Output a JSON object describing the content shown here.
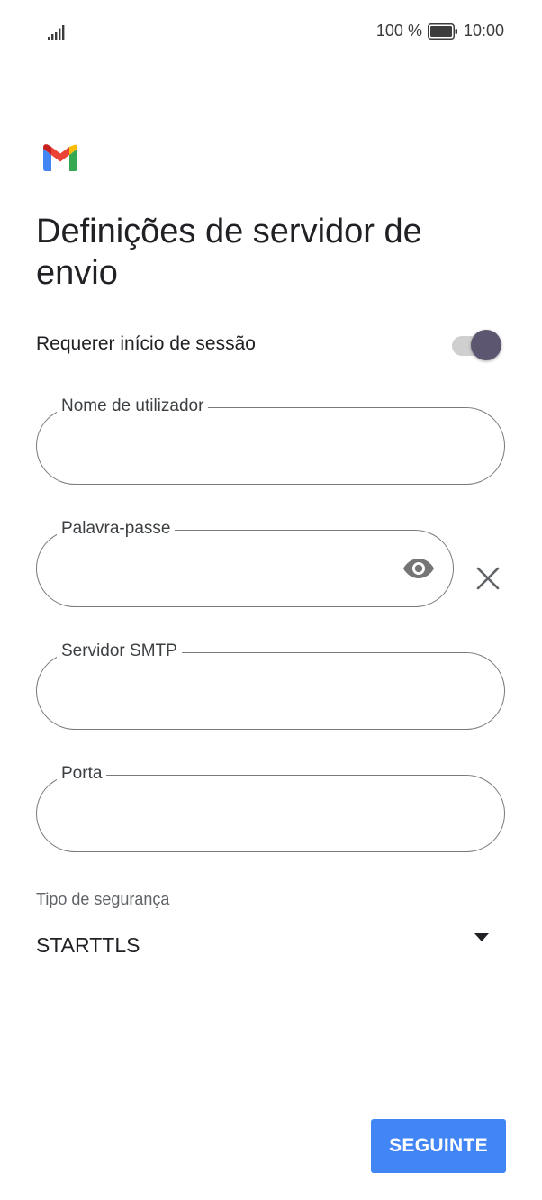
{
  "status_bar": {
    "battery_percent": "100 %",
    "time": "10:00",
    "signal_icon": "signal-bars-icon",
    "battery_icon": "battery-full-icon"
  },
  "header": {
    "logo_icon": "gmail-logo",
    "title": "Definições de servidor de envio"
  },
  "signin_toggle": {
    "label": "Requerer início de sessão",
    "checked": true
  },
  "fields": {
    "username": {
      "label": "Nome de utilizador",
      "value": ""
    },
    "password": {
      "label": "Palavra-passe",
      "value": "",
      "visibility_icon": "eye-icon",
      "clear_icon": "close-icon"
    },
    "smtp_server": {
      "label": "Servidor SMTP",
      "value": ""
    },
    "port": {
      "label": "Porta",
      "value": ""
    }
  },
  "security": {
    "label": "Tipo de segurança",
    "selected": "STARTTLS",
    "arrow_icon": "dropdown-arrow-icon"
  },
  "footer": {
    "next_label": "SEGUINTE"
  },
  "colors": {
    "primary_button": "#4285f4",
    "toggle_thumb": "#5d5670",
    "toggle_track": "#cfcfcf",
    "field_border": "#7a7a7a"
  }
}
